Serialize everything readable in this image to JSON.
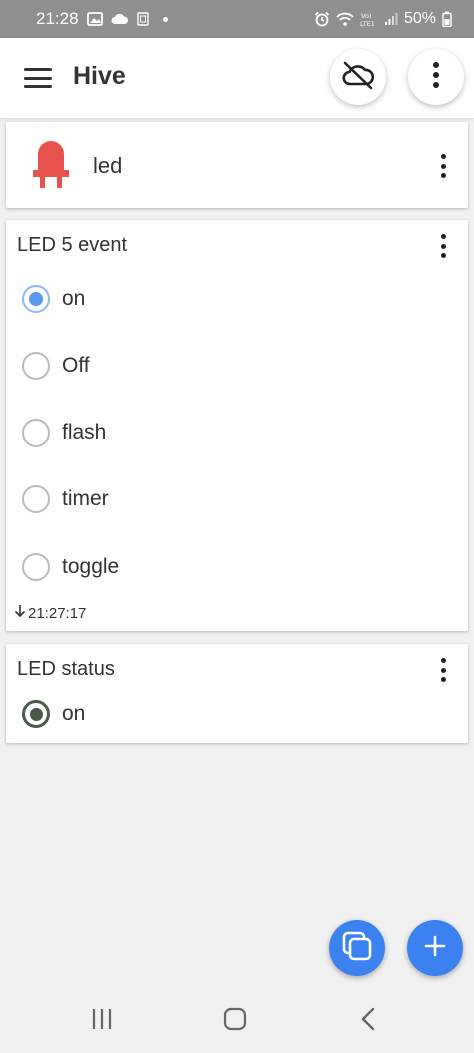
{
  "status_bar": {
    "time": "21:28",
    "battery": "50%",
    "icons": [
      "gallery-icon",
      "cloud-icon",
      "sim-icon",
      "alarm-icon",
      "wifi-icon",
      "volte-icon",
      "signal-icon",
      "battery-icon"
    ]
  },
  "app_bar": {
    "title": "Hive",
    "icons": [
      "menu-icon",
      "cloud-off-icon",
      "more-vert-icon"
    ]
  },
  "device_card": {
    "name": "led",
    "icon": "led-icon",
    "icon_color": "#e8524d"
  },
  "event_card": {
    "title": "LED 5 event",
    "options": [
      {
        "label": "on",
        "selected": true
      },
      {
        "label": "Off",
        "selected": false
      },
      {
        "label": "flash",
        "selected": false
      },
      {
        "label": "timer",
        "selected": false
      },
      {
        "label": "toggle",
        "selected": false
      }
    ],
    "timestamp": "21:27:17"
  },
  "status_card": {
    "title": "LED status",
    "value": "on"
  },
  "fabs": {
    "icons": [
      "copy-icon",
      "add-icon"
    ],
    "color": "#3b82f0"
  },
  "nav_bar": {
    "icons": [
      "recents-icon",
      "home-icon",
      "back-icon"
    ]
  }
}
